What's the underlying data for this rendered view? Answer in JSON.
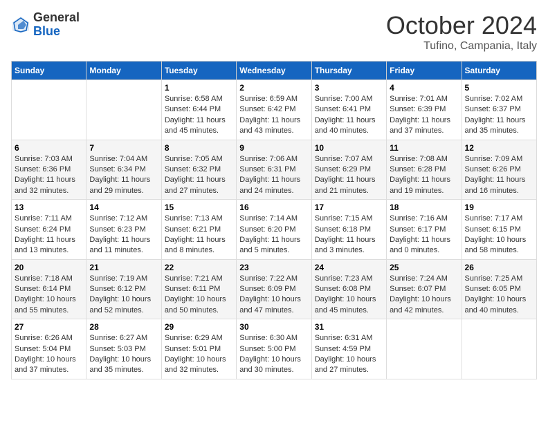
{
  "header": {
    "logo_general": "General",
    "logo_blue": "Blue",
    "month_title": "October 2024",
    "location": "Tufino, Campania, Italy"
  },
  "calendar": {
    "weekdays": [
      "Sunday",
      "Monday",
      "Tuesday",
      "Wednesday",
      "Thursday",
      "Friday",
      "Saturday"
    ],
    "weeks": [
      [
        {
          "day": "",
          "info": ""
        },
        {
          "day": "",
          "info": ""
        },
        {
          "day": "1",
          "info": "Sunrise: 6:58 AM\nSunset: 6:44 PM\nDaylight: 11 hours\nand 45 minutes."
        },
        {
          "day": "2",
          "info": "Sunrise: 6:59 AM\nSunset: 6:42 PM\nDaylight: 11 hours\nand 43 minutes."
        },
        {
          "day": "3",
          "info": "Sunrise: 7:00 AM\nSunset: 6:41 PM\nDaylight: 11 hours\nand 40 minutes."
        },
        {
          "day": "4",
          "info": "Sunrise: 7:01 AM\nSunset: 6:39 PM\nDaylight: 11 hours\nand 37 minutes."
        },
        {
          "day": "5",
          "info": "Sunrise: 7:02 AM\nSunset: 6:37 PM\nDaylight: 11 hours\nand 35 minutes."
        }
      ],
      [
        {
          "day": "6",
          "info": "Sunrise: 7:03 AM\nSunset: 6:36 PM\nDaylight: 11 hours\nand 32 minutes."
        },
        {
          "day": "7",
          "info": "Sunrise: 7:04 AM\nSunset: 6:34 PM\nDaylight: 11 hours\nand 29 minutes."
        },
        {
          "day": "8",
          "info": "Sunrise: 7:05 AM\nSunset: 6:32 PM\nDaylight: 11 hours\nand 27 minutes."
        },
        {
          "day": "9",
          "info": "Sunrise: 7:06 AM\nSunset: 6:31 PM\nDaylight: 11 hours\nand 24 minutes."
        },
        {
          "day": "10",
          "info": "Sunrise: 7:07 AM\nSunset: 6:29 PM\nDaylight: 11 hours\nand 21 minutes."
        },
        {
          "day": "11",
          "info": "Sunrise: 7:08 AM\nSunset: 6:28 PM\nDaylight: 11 hours\nand 19 minutes."
        },
        {
          "day": "12",
          "info": "Sunrise: 7:09 AM\nSunset: 6:26 PM\nDaylight: 11 hours\nand 16 minutes."
        }
      ],
      [
        {
          "day": "13",
          "info": "Sunrise: 7:11 AM\nSunset: 6:24 PM\nDaylight: 11 hours\nand 13 minutes."
        },
        {
          "day": "14",
          "info": "Sunrise: 7:12 AM\nSunset: 6:23 PM\nDaylight: 11 hours\nand 11 minutes."
        },
        {
          "day": "15",
          "info": "Sunrise: 7:13 AM\nSunset: 6:21 PM\nDaylight: 11 hours\nand 8 minutes."
        },
        {
          "day": "16",
          "info": "Sunrise: 7:14 AM\nSunset: 6:20 PM\nDaylight: 11 hours\nand 5 minutes."
        },
        {
          "day": "17",
          "info": "Sunrise: 7:15 AM\nSunset: 6:18 PM\nDaylight: 11 hours\nand 3 minutes."
        },
        {
          "day": "18",
          "info": "Sunrise: 7:16 AM\nSunset: 6:17 PM\nDaylight: 11 hours\nand 0 minutes."
        },
        {
          "day": "19",
          "info": "Sunrise: 7:17 AM\nSunset: 6:15 PM\nDaylight: 10 hours\nand 58 minutes."
        }
      ],
      [
        {
          "day": "20",
          "info": "Sunrise: 7:18 AM\nSunset: 6:14 PM\nDaylight: 10 hours\nand 55 minutes."
        },
        {
          "day": "21",
          "info": "Sunrise: 7:19 AM\nSunset: 6:12 PM\nDaylight: 10 hours\nand 52 minutes."
        },
        {
          "day": "22",
          "info": "Sunrise: 7:21 AM\nSunset: 6:11 PM\nDaylight: 10 hours\nand 50 minutes."
        },
        {
          "day": "23",
          "info": "Sunrise: 7:22 AM\nSunset: 6:09 PM\nDaylight: 10 hours\nand 47 minutes."
        },
        {
          "day": "24",
          "info": "Sunrise: 7:23 AM\nSunset: 6:08 PM\nDaylight: 10 hours\nand 45 minutes."
        },
        {
          "day": "25",
          "info": "Sunrise: 7:24 AM\nSunset: 6:07 PM\nDaylight: 10 hours\nand 42 minutes."
        },
        {
          "day": "26",
          "info": "Sunrise: 7:25 AM\nSunset: 6:05 PM\nDaylight: 10 hours\nand 40 minutes."
        }
      ],
      [
        {
          "day": "27",
          "info": "Sunrise: 6:26 AM\nSunset: 5:04 PM\nDaylight: 10 hours\nand 37 minutes."
        },
        {
          "day": "28",
          "info": "Sunrise: 6:27 AM\nSunset: 5:03 PM\nDaylight: 10 hours\nand 35 minutes."
        },
        {
          "day": "29",
          "info": "Sunrise: 6:29 AM\nSunset: 5:01 PM\nDaylight: 10 hours\nand 32 minutes."
        },
        {
          "day": "30",
          "info": "Sunrise: 6:30 AM\nSunset: 5:00 PM\nDaylight: 10 hours\nand 30 minutes."
        },
        {
          "day": "31",
          "info": "Sunrise: 6:31 AM\nSunset: 4:59 PM\nDaylight: 10 hours\nand 27 minutes."
        },
        {
          "day": "",
          "info": ""
        },
        {
          "day": "",
          "info": ""
        }
      ]
    ]
  }
}
